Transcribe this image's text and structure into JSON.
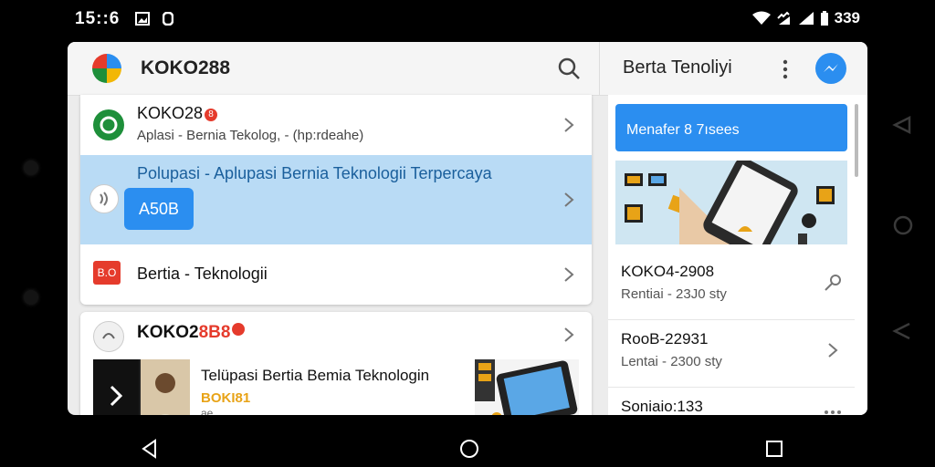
{
  "status_bar": {
    "time": "15::6",
    "battery_text": "339",
    "icons": [
      "gallery-icon",
      "notification-icon",
      "wifi-icon",
      "signal-icon",
      "battery-icon"
    ]
  },
  "app_bar": {
    "title": "KOKO288",
    "right_title": "Berta Tenoliyi",
    "icons": [
      "logo",
      "search-icon",
      "more-icon",
      "messenger-icon"
    ]
  },
  "left_list": [
    {
      "title": "KOKO28",
      "badge": "8",
      "subtitle": "Aplasi - Bernia Tekolog, - (hp:rdeahe)",
      "icon_color": "#1e8f3a"
    },
    {
      "title": "Polupasi - Aplupasi Bernia Teknologii Terpercaya",
      "chip": "A50B",
      "highlighted": true
    },
    {
      "title": "Bertia - Teknologii",
      "icon_text": "B.O",
      "icon_color": "#e53b2c"
    }
  ],
  "card2": {
    "title_main": "KOKO2",
    "title_accent": "8B8",
    "headline": "Telüpasi Bertia Bemia Teknologin",
    "tag": "BOKI81",
    "meta": "ae"
  },
  "right_panel": {
    "promo_label": "Menafer 8 7ısees",
    "items": [
      {
        "title": "KOKO4-2908",
        "subtitle": "Rentiai - 23J0 sty",
        "icon": "pin-icon"
      },
      {
        "title": "RooB-22931",
        "subtitle": "Lentai - 2300 sty",
        "icon": "chevron-right-icon"
      },
      {
        "title": "Soniaio:133",
        "subtitle": "",
        "icon": "more-horiz-icon"
      }
    ]
  },
  "colors": {
    "accent": "#2b8ef0",
    "highlight": "#b9dbf5",
    "badge": "#e53b2c"
  }
}
